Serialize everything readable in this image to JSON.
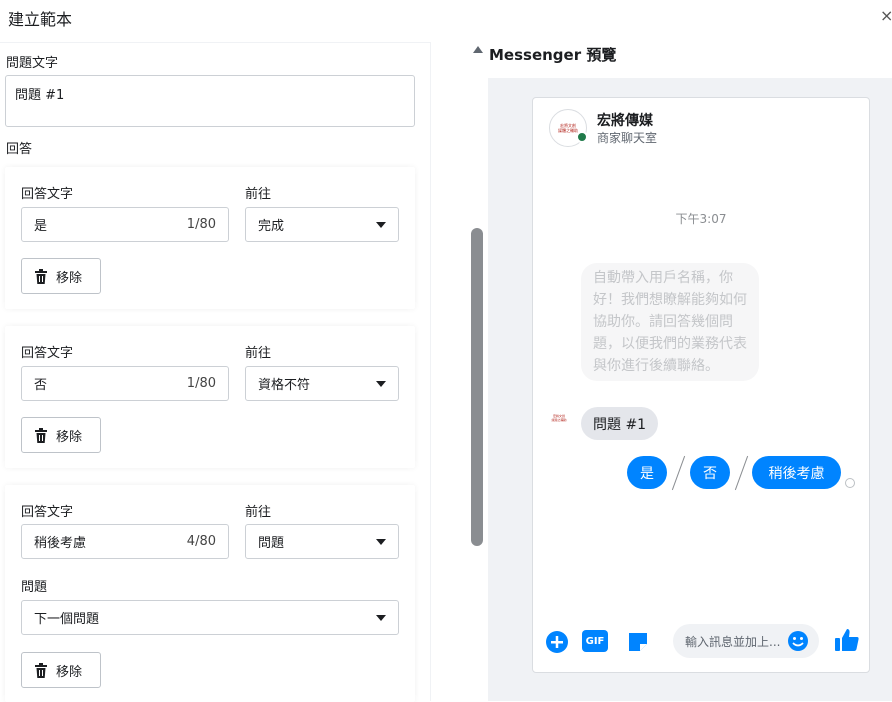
{
  "header": {
    "title": "建立範本",
    "close_label": "×"
  },
  "left": {
    "question_label": "問題文字",
    "question_value": "問題 #1",
    "answers_label": "回答",
    "answer_text_label": "回答文字",
    "goto_label": "前往",
    "question_select_label": "問題",
    "remove_label": "移除",
    "answers": [
      {
        "text": "是",
        "count": "1/80",
        "goto": "完成"
      },
      {
        "text": "否",
        "count": "1/80",
        "goto": "資格不符"
      },
      {
        "text": "稍後考慮",
        "count": "4/80",
        "goto": "問題",
        "question": "下一個問題"
      }
    ]
  },
  "preview": {
    "title": "Messenger 預覽",
    "page_name": "宏將傳媒",
    "page_subtitle": "商家聊天室",
    "time": "下午3:07",
    "greeting": "自動帶入用戶名稱，你好！我們想瞭解能夠如何協助你。請回答幾個問題，以便我們的業務代表與你進行後續聯絡。",
    "question_bubble": "問題 #1",
    "quick_replies": [
      "是",
      "否",
      "稍後考慮"
    ],
    "composer_placeholder": "輸入訊息並加上...",
    "gif_label": "GIF",
    "logo_text": "宏將文創 媒體之輔助"
  },
  "colors": {
    "messenger_blue": "#0084ff",
    "online_green": "#1f7a4a"
  }
}
